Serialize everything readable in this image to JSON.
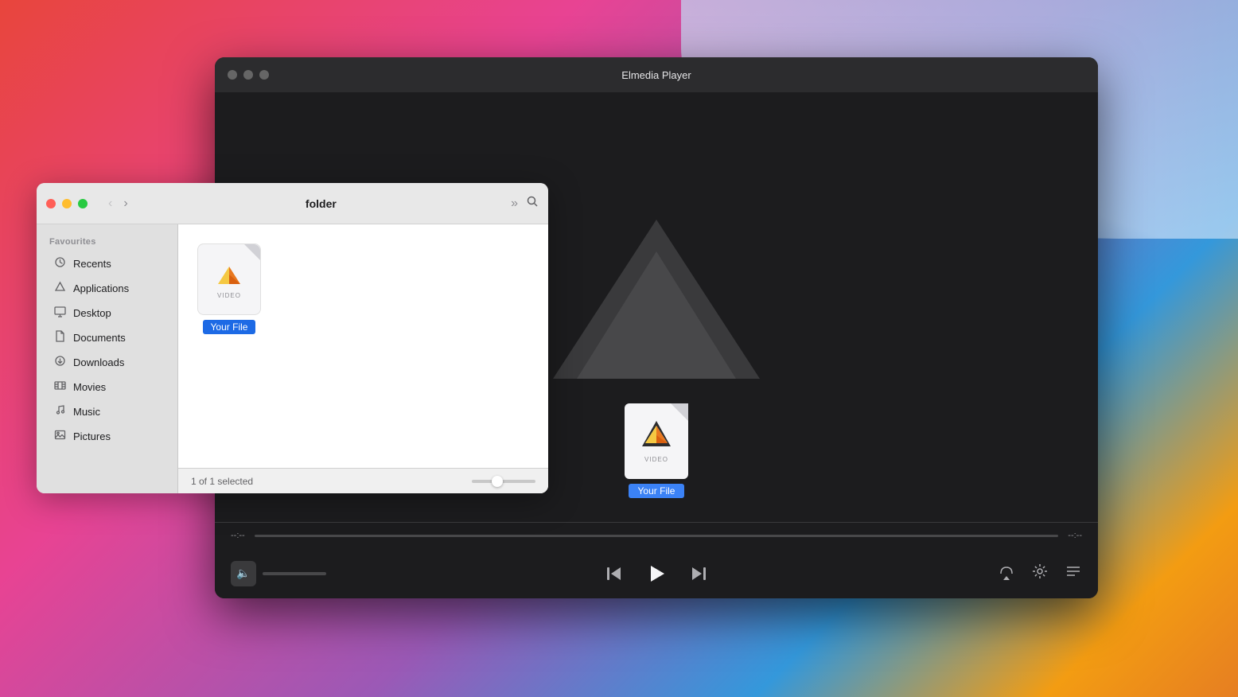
{
  "background": {
    "gradient": "macOS Big Sur"
  },
  "player": {
    "title": "Elmedia Player",
    "traffic_lights": {
      "close": "close",
      "minimize": "minimize",
      "maximize": "maximize"
    },
    "time_start": "--:--",
    "time_end": "--:--",
    "file": {
      "name": "Your File",
      "type": "VIDEO"
    },
    "controls": {
      "prev": "⏮",
      "play": "▶",
      "next": "⏭",
      "airplay": "airplay",
      "settings": "settings",
      "playlist": "playlist"
    },
    "volume": {
      "icon": "🔈"
    }
  },
  "finder": {
    "title": "folder",
    "traffic_lights": {
      "close": "close",
      "minimize": "minimize",
      "maximize": "maximize"
    },
    "navigation": {
      "back": "‹",
      "forward": "›"
    },
    "toolbar": {
      "more": "»",
      "search": "search"
    },
    "sidebar": {
      "section_label": "Favourites",
      "items": [
        {
          "id": "recents",
          "label": "Recents",
          "icon": "🕐"
        },
        {
          "id": "applications",
          "label": "Applications",
          "icon": "🚀"
        },
        {
          "id": "desktop",
          "label": "Desktop",
          "icon": "🖥"
        },
        {
          "id": "documents",
          "label": "Documents",
          "icon": "📄"
        },
        {
          "id": "downloads",
          "label": "Downloads",
          "icon": "⬇"
        },
        {
          "id": "movies",
          "label": "Movies",
          "icon": "🎞"
        },
        {
          "id": "music",
          "label": "Music",
          "icon": "🎵"
        },
        {
          "id": "pictures",
          "label": "Pictures",
          "icon": "🖼"
        }
      ]
    },
    "file": {
      "name": "Your File",
      "type": "VIDEO"
    },
    "statusbar": {
      "selection": "1 of 1 selected"
    }
  }
}
